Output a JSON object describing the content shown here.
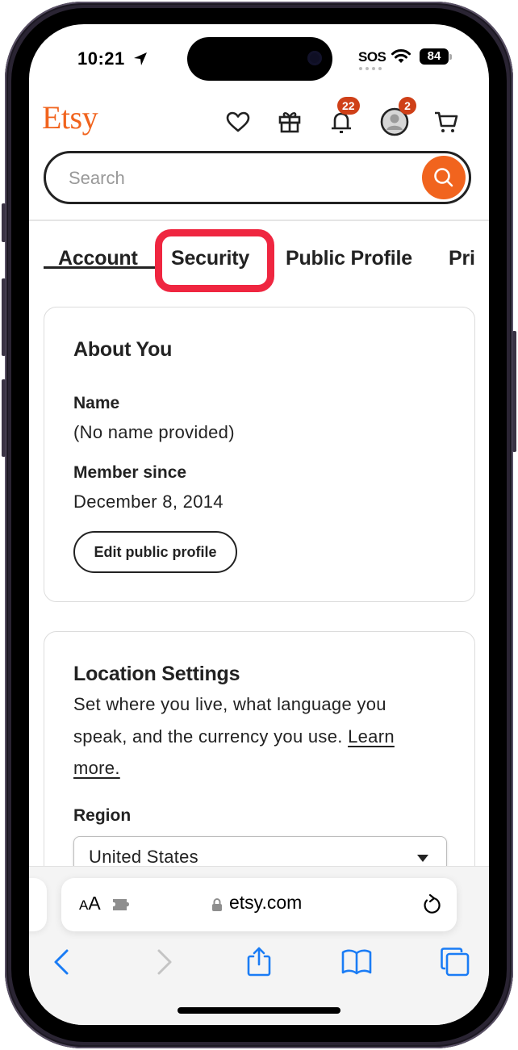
{
  "status_bar": {
    "time": "10:21",
    "carrier_status": "SOS",
    "battery_level": "84"
  },
  "header": {
    "logo": "Etsy",
    "icons": [
      "heart-icon",
      "gift-icon",
      "bell-icon",
      "avatar",
      "cart-icon"
    ],
    "notifications_badge": "22",
    "account_badge": "2",
    "brand_color": "#f1641e",
    "badge_color": "#cf4018"
  },
  "search": {
    "placeholder": "Search",
    "value": ""
  },
  "tabs": [
    {
      "label": "Account",
      "active": true
    },
    {
      "label": "Security",
      "active": false,
      "highlighted": true
    },
    {
      "label": "Public Profile",
      "active": false
    },
    {
      "label": "Pri",
      "active": false
    }
  ],
  "highlight_color": "#ef2640",
  "about_card": {
    "title": "About You",
    "name_label": "Name",
    "name_value": "(No name provided)",
    "member_label": "Member since",
    "member_value": "December 8, 2014",
    "edit_button": "Edit public profile"
  },
  "location_card": {
    "title": "Location Settings",
    "description": "Set where you live, what language you speak, and the currency you use.",
    "learn_more": "Learn more.",
    "region_label": "Region",
    "region_value": "United States"
  },
  "safari": {
    "text_size_small": "A",
    "text_size_large": "A",
    "url": "etsy.com",
    "accent_color": "#1a7cf5"
  }
}
